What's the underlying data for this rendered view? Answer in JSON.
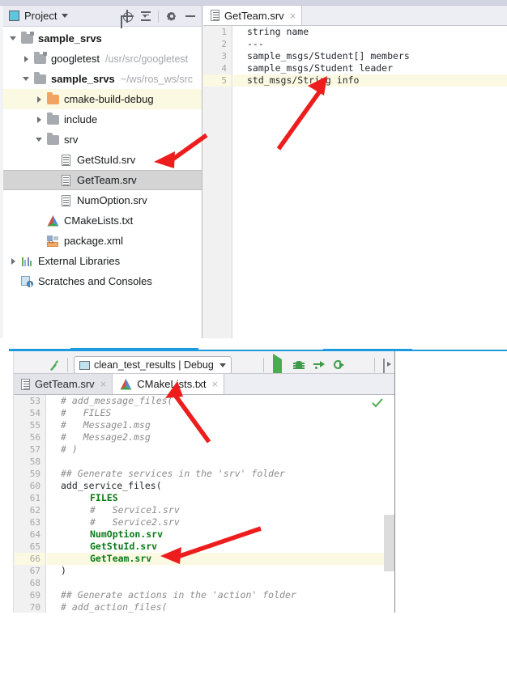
{
  "top_window": {
    "project_panel": {
      "title": "Project",
      "icons": [
        "project-window-icon",
        "chevron-down-icon",
        "locate-icon",
        "collapse-all-icon",
        "gear-icon",
        "minimize-icon"
      ],
      "tree": [
        {
          "label": "sample_srvs",
          "path": "",
          "indent": 0,
          "twisty": "open",
          "icon": "folder-module-icon",
          "bold": true,
          "state": "normal"
        },
        {
          "label": "googletest",
          "path": "/usr/src/googletest",
          "indent": 1,
          "twisty": "closed",
          "icon": "folder-module-icon",
          "bold": false,
          "state": "normal"
        },
        {
          "label": "sample_srvs",
          "path": "~/ws/ros_ws/src",
          "indent": 1,
          "twisty": "open",
          "icon": "folder-icon",
          "bold": true,
          "state": "normal"
        },
        {
          "label": "cmake-build-debug",
          "path": "",
          "indent": 2,
          "twisty": "closed",
          "icon": "folder-orange-icon",
          "bold": false,
          "state": "highlight"
        },
        {
          "label": "include",
          "path": "",
          "indent": 2,
          "twisty": "closed",
          "icon": "folder-icon",
          "bold": false,
          "state": "normal"
        },
        {
          "label": "srv",
          "path": "",
          "indent": 2,
          "twisty": "open",
          "icon": "folder-icon",
          "bold": false,
          "state": "normal"
        },
        {
          "label": "GetStuId.srv",
          "path": "",
          "indent": 3,
          "twisty": "none",
          "icon": "srv-file-icon",
          "bold": false,
          "state": "normal"
        },
        {
          "label": "GetTeam.srv",
          "path": "",
          "indent": 3,
          "twisty": "none",
          "icon": "srv-file-icon",
          "bold": false,
          "state": "selected"
        },
        {
          "label": "NumOption.srv",
          "path": "",
          "indent": 3,
          "twisty": "none",
          "icon": "srv-file-icon",
          "bold": false,
          "state": "normal"
        },
        {
          "label": "CMakeLists.txt",
          "path": "",
          "indent": 2,
          "twisty": "none",
          "icon": "cmake-icon",
          "bold": false,
          "state": "normal"
        },
        {
          "label": "package.xml",
          "path": "",
          "indent": 2,
          "twisty": "none",
          "icon": "xml-file-icon",
          "bold": false,
          "state": "normal"
        },
        {
          "label": "External Libraries",
          "path": "",
          "indent": 0,
          "twisty": "closed",
          "icon": "libraries-icon",
          "bold": false,
          "state": "normal"
        },
        {
          "label": "Scratches and Consoles",
          "path": "",
          "indent": 0,
          "twisty": "none",
          "icon": "scratches-icon",
          "bold": false,
          "state": "normal"
        }
      ]
    },
    "editor": {
      "tabs": [
        {
          "label": "GetTeam.srv",
          "icon": "srv-file-icon",
          "active": true,
          "close": "×"
        }
      ],
      "lines": [
        {
          "no": "1",
          "text": "string name",
          "hl": false
        },
        {
          "no": "2",
          "text": "---",
          "hl": false
        },
        {
          "no": "3",
          "text": "sample_msgs/Student[] members",
          "hl": false
        },
        {
          "no": "4",
          "text": "sample_msgs/Student leader",
          "hl": false
        },
        {
          "no": "5",
          "text": "std_msgs/String info",
          "hl": true
        }
      ]
    }
  },
  "bottom_window": {
    "run_toolbar": {
      "config_name": "clean_test_results | Debug",
      "config_icon": "run-config-icon",
      "caret": "chevron-down-icon",
      "buttons": [
        "run-icon",
        "debug-icon",
        "step-over-icon",
        "rerun-icon",
        "stop-icon",
        "console-icon"
      ]
    },
    "editor": {
      "tabs": [
        {
          "label": "GetTeam.srv",
          "icon": "srv-file-icon",
          "active": false,
          "close": "×"
        },
        {
          "label": "CMakeLists.txt",
          "icon": "cmake-icon",
          "active": true,
          "close": "×"
        }
      ],
      "inspection_status": "ok-check-icon",
      "lines": [
        {
          "no": "53",
          "segs": [
            {
              "t": "# add_message_files(",
              "c": "tok-comment"
            }
          ],
          "indent": 0,
          "hl": false
        },
        {
          "no": "54",
          "segs": [
            {
              "t": "#   FILES",
              "c": "tok-comment"
            }
          ],
          "indent": 0,
          "hl": false
        },
        {
          "no": "55",
          "segs": [
            {
              "t": "#   Message1.msg",
              "c": "tok-comment"
            }
          ],
          "indent": 0,
          "hl": false
        },
        {
          "no": "56",
          "segs": [
            {
              "t": "#   Message2.msg",
              "c": "tok-comment"
            }
          ],
          "indent": 0,
          "hl": false
        },
        {
          "no": "57",
          "segs": [
            {
              "t": "# )",
              "c": "tok-comment"
            }
          ],
          "indent": 0,
          "hl": false
        },
        {
          "no": "58",
          "segs": [],
          "indent": 0,
          "hl": false
        },
        {
          "no": "59",
          "segs": [
            {
              "t": "## Generate services in the 'srv' folder",
              "c": "tok-comment"
            }
          ],
          "indent": 0,
          "hl": false
        },
        {
          "no": "60",
          "segs": [
            {
              "t": "add_service_files(",
              "c": "tok-plain"
            }
          ],
          "indent": 0,
          "hl": false
        },
        {
          "no": "61",
          "segs": [
            {
              "t": "FILES",
              "c": "tok-kw"
            }
          ],
          "indent": 1,
          "hl": false
        },
        {
          "no": "62",
          "segs": [
            {
              "t": "#   Service1.srv",
              "c": "tok-comment"
            }
          ],
          "indent": 1,
          "hl": false
        },
        {
          "no": "63",
          "segs": [
            {
              "t": "#   Service2.srv",
              "c": "tok-comment"
            }
          ],
          "indent": 1,
          "hl": false
        },
        {
          "no": "64",
          "segs": [
            {
              "t": "NumOption.srv",
              "c": "tok-kw"
            }
          ],
          "indent": 1,
          "hl": false
        },
        {
          "no": "65",
          "segs": [
            {
              "t": "GetStuId.srv",
              "c": "tok-kw"
            }
          ],
          "indent": 1,
          "hl": false
        },
        {
          "no": "66",
          "segs": [
            {
              "t": "GetTeam.srv",
              "c": "tok-kw"
            }
          ],
          "indent": 1,
          "hl": true
        },
        {
          "no": "67",
          "segs": [
            {
              "t": ")",
              "c": "tok-plain"
            }
          ],
          "indent": 0,
          "hl": false
        },
        {
          "no": "68",
          "segs": [],
          "indent": 0,
          "hl": false
        },
        {
          "no": "69",
          "segs": [
            {
              "t": "## Generate actions in the 'action' folder",
              "c": "tok-comment"
            }
          ],
          "indent": 0,
          "hl": false
        },
        {
          "no": "70",
          "segs": [
            {
              "t": "# add_action_files(",
              "c": "tok-comment"
            }
          ],
          "indent": 0,
          "hl": false
        }
      ]
    }
  },
  "annotations": {
    "arrow_color": "#ee1d1d",
    "separator_color": "#1b9ae0",
    "arrows": [
      {
        "name": "arrow-to-getteam-srv-tree"
      },
      {
        "name": "arrow-to-std-msgs-string-line"
      },
      {
        "name": "arrow-to-cmakelists-tab"
      },
      {
        "name": "arrow-to-getteam-srv-line66"
      }
    ]
  }
}
